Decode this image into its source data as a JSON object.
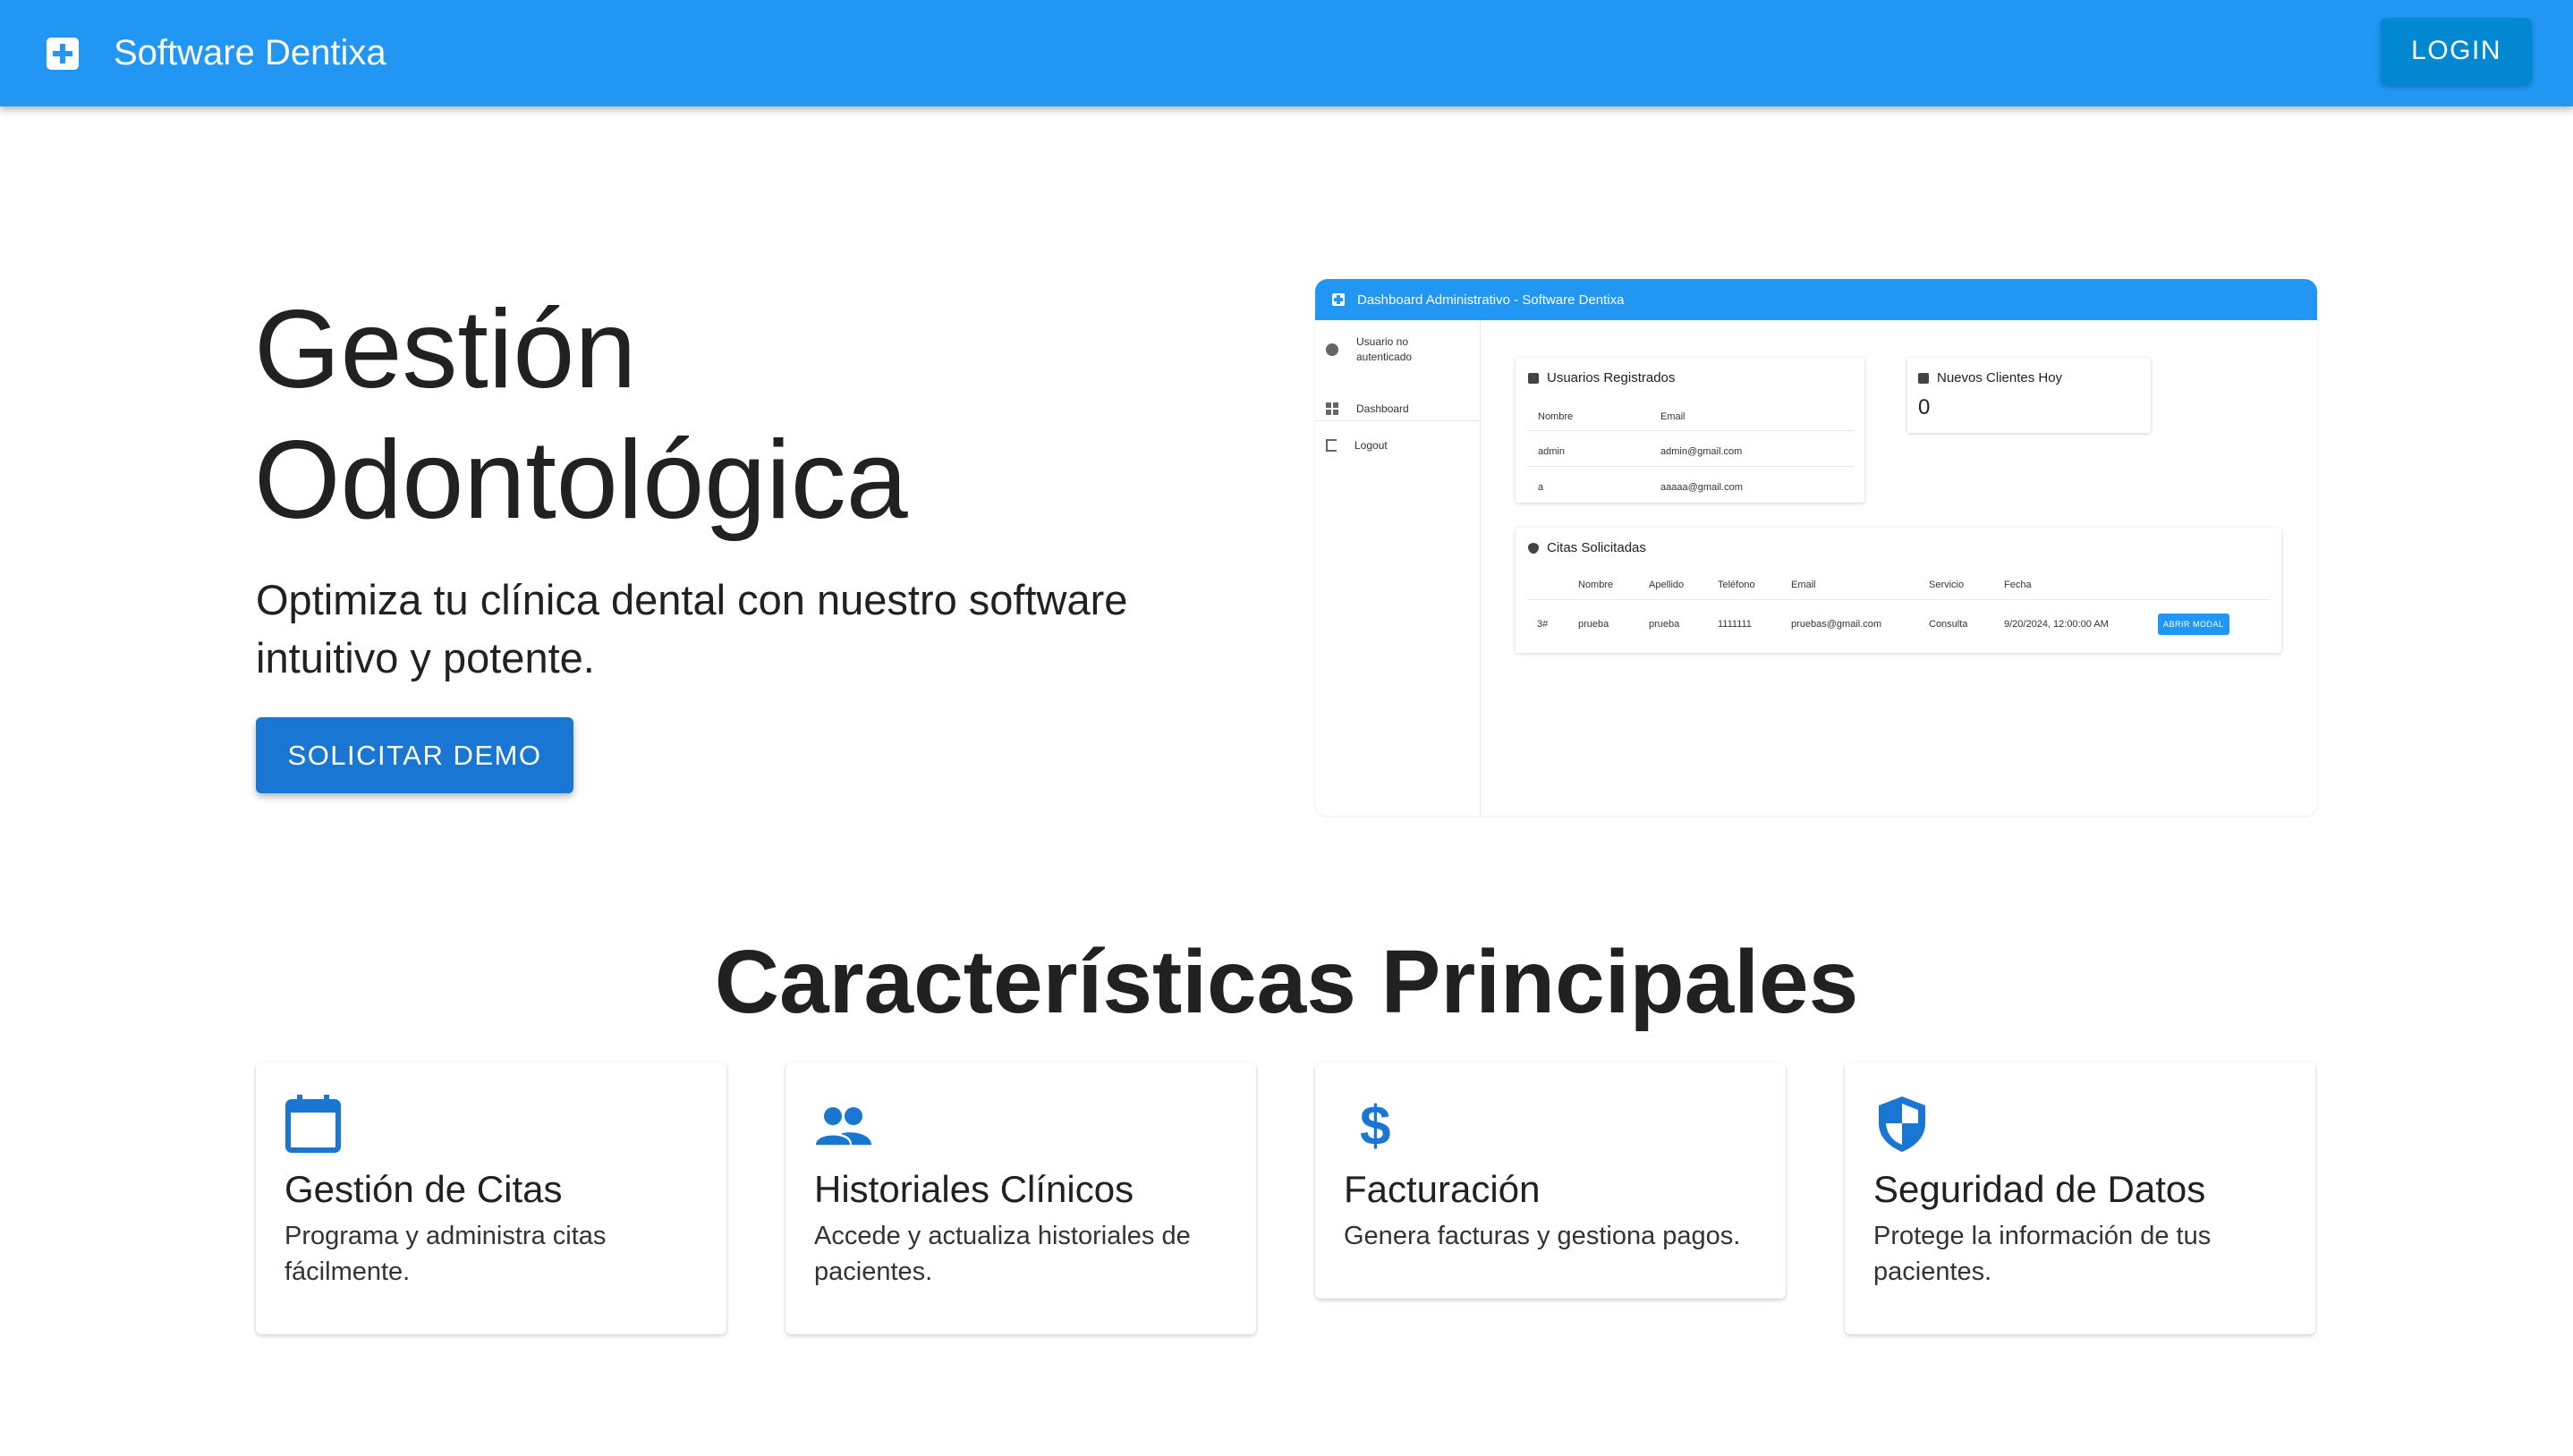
{
  "appbar": {
    "title": "Software Dentixa",
    "login_label": "LOGIN",
    "accent": "#2196f3"
  },
  "hero": {
    "title_line1": "Gestión",
    "title_line2": "Odontológica",
    "subtitle": "Optimiza tu clínica dental con nuestro software intuitivo y potente.",
    "cta_label": "SOLICITAR DEMO"
  },
  "preview": {
    "bar_title": "Dashboard Administrativo - Software Dentixa",
    "sidebar": {
      "user": "Usuario no autenticado",
      "dashboard": "Dashboard",
      "logout": "Logout"
    },
    "users_card": {
      "title": "Usuarios Registrados",
      "headers": [
        "Nombre",
        "Email"
      ],
      "rows": [
        [
          "admin",
          "admin@gmail.com"
        ],
        [
          "a",
          "aaaaa@gmail.com"
        ]
      ]
    },
    "clients_card": {
      "title": "Nuevos Clientes Hoy",
      "value": "0"
    },
    "citas_card": {
      "title": "Citas Solicitadas",
      "headers": [
        "Nombre",
        "Apellido",
        "Teléfono",
        "Email",
        "Servicio",
        "Fecha"
      ],
      "row": {
        "id": "3#",
        "nombre": "prueba",
        "apellido": "prueba",
        "telefono": "1111111",
        "email": "pruebas@gmail.com",
        "servicio": "Consulta",
        "fecha": "9/20/2024, 12:00:00 AM",
        "action": "ABRIR MODAL"
      }
    }
  },
  "features": {
    "heading": "Características Principales",
    "icon_color": "#1976d2",
    "items": [
      {
        "icon": "calendar-icon",
        "title": "Gestión de Citas",
        "desc": "Programa y administra citas fácilmente."
      },
      {
        "icon": "people-icon",
        "title": "Historiales Clínicos",
        "desc": "Accede y actualiza historiales de pacientes."
      },
      {
        "icon": "dollar-icon",
        "title": "Facturación",
        "desc": "Genera facturas y gestiona pagos."
      },
      {
        "icon": "shield-icon",
        "title": "Seguridad de Datos",
        "desc": "Protege la información de tus pacientes."
      }
    ]
  }
}
